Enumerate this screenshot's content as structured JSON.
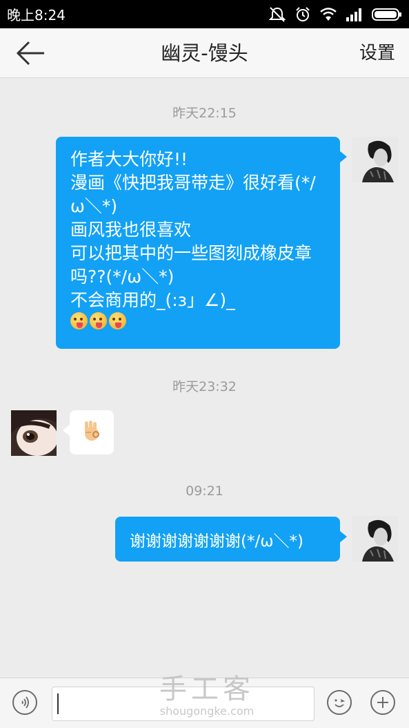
{
  "status_bar": {
    "time": "晚上8:24",
    "icons": [
      "mute-icon",
      "alarm-icon",
      "wifi-icon",
      "signal-icon",
      "battery-icon"
    ]
  },
  "header": {
    "back_icon": "back-arrow-icon",
    "title": "幽灵-馒头",
    "settings": "设置"
  },
  "messages": [
    {
      "timestamp": "昨天22:15",
      "side": "right",
      "lines": [
        "作者大大你好!!",
        "漫画《快把我哥带走》很好看(*/",
        "ω＼*)",
        "画风我也很喜欢",
        "可以把其中的一些图刻成橡皮章",
        "吗??(*/ω＼*)",
        "不会商用的_(:з」∠)_"
      ],
      "emojis": [
        "tongue-face-emoji",
        "tongue-face-emoji",
        "tongue-face-emoji"
      ]
    },
    {
      "timestamp": "昨天23:32",
      "side": "left",
      "content_icon": "ok-hand-emoji"
    },
    {
      "timestamp": "09:21",
      "side": "right",
      "lines": [
        "谢谢谢谢谢谢谢(*/ω＼*)"
      ]
    }
  ],
  "input_bar": {
    "voice_icon": "voice-icon",
    "input_value": "",
    "emoji_icon": "smiley-icon",
    "plus_icon": "plus-icon"
  },
  "watermark": {
    "main": "手工客",
    "sub": "shougongke.com"
  },
  "colors": {
    "bubble_sent": "#12a1f5",
    "bubble_received": "#ffffff",
    "background": "#ececec"
  }
}
